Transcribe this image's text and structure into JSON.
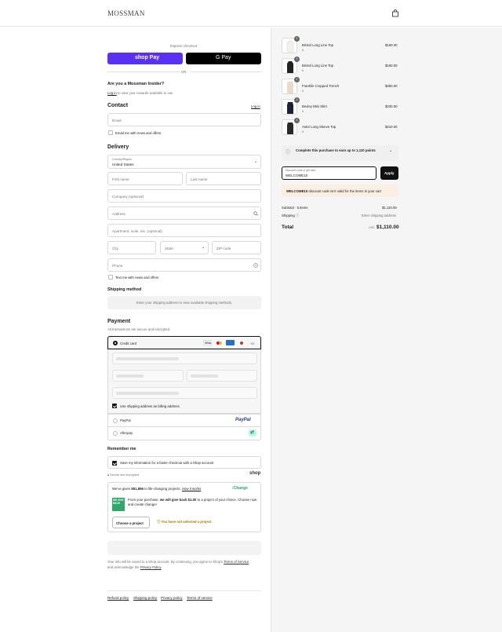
{
  "header": {
    "logo": "MOSSMAN",
    "bag_icon": "shopping-bag-icon"
  },
  "express": {
    "title": "Express checkout",
    "shop_pay_label": "shop Pay",
    "gpay_label": "G Pay",
    "or_label": "OR"
  },
  "insider": {
    "title": "Are you a Mossman Insider?",
    "login_link": "Log in",
    "text": " to view your rewards available to use."
  },
  "contact": {
    "title": "Contact",
    "login_link": "Log in",
    "email_placeholder": "Email",
    "newsletter_label": "Email me with news and offers"
  },
  "delivery": {
    "title": "Delivery",
    "country_label": "Country/Region",
    "country_value": "United States",
    "first_name": "First name",
    "last_name": "Last name",
    "company": "Company (optional)",
    "address": "Address",
    "apartment": "Apartment, suite, etc. (optional)",
    "city": "City",
    "state": "State",
    "zip": "ZIP code",
    "phone": "Phone",
    "sms_label": "Text me with news and offers"
  },
  "shipping_method": {
    "title": "Shipping method",
    "notice": "Enter your shipping address to view available shipping methods."
  },
  "payment": {
    "title": "Payment",
    "subtitle": "All transactions are secure and encrypted.",
    "credit_card": "Credit card",
    "more_cards": "+2",
    "use_shipping": "Use shipping address as billing address",
    "paypal": "PayPal",
    "paypal_logo": "PayPal",
    "afterpay": "Afterpay"
  },
  "remember": {
    "title": "Remember me",
    "save_label": "Save my information for a faster checkout with a Shop account",
    "secure": "Secure and encrypted",
    "shop_logo": "shop"
  },
  "change": {
    "given_prefix": "We've given ",
    "given_amount": "$51,856",
    "given_suffix": " to life-changing projects.",
    "how_link": "How it works",
    "brand": "Change",
    "badge": "WE GIVE BACK",
    "body_prefix": "From your purchase, ",
    "body_bold": "we will give back $1.00",
    "body_suffix": " to a project of your choice. Choose now and create change!",
    "choose_button": "Choose a project",
    "warning": "You have not selected a project"
  },
  "legal": {
    "text1": "Your info will be saved to a Shop account. By continuing, you agree to Shop's ",
    "terms": "Terms of Service",
    "text2": "and acknowledge the ",
    "privacy": "Privacy Policy"
  },
  "footer": {
    "refund": "Refund policy",
    "shipping": "Shipping policy",
    "privacy": "Privacy policy",
    "terms": "Terms of service"
  },
  "cart": {
    "items": [
      {
        "name": "Bristol Long Line Top",
        "variant": "6",
        "price": "$160.00",
        "qty": "1"
      },
      {
        "name": "Bristol Long Line Top",
        "variant": "6",
        "price": "$160.00",
        "qty": "1"
      },
      {
        "name": "Franklin Cropped Trench",
        "variant": "6",
        "price": "$350.00",
        "qty": "1"
      },
      {
        "name": "Bexley Mini Skirt",
        "variant": "6",
        "price": "$230.00",
        "qty": "1"
      },
      {
        "name": "Astor Long Sleeve Top",
        "variant": "6",
        "price": "$210.00",
        "qty": "1"
      }
    ],
    "points_text": "Complete this purchase to earn up to 1,110 points",
    "discount_label": "Discount code or gift card",
    "discount_value": "WELCOME10",
    "apply_button": "Apply",
    "error_code": "WELCOME10",
    "error_text": " discount code isn't valid for the items in your cart",
    "subtotal_label": "Subtotal · 5 items",
    "subtotal_value": "$1,110.00",
    "shipping_label": "Shipping",
    "shipping_value": "Enter shipping address",
    "total_label": "Total",
    "currency": "USD",
    "total_value": "$1,110.00"
  }
}
